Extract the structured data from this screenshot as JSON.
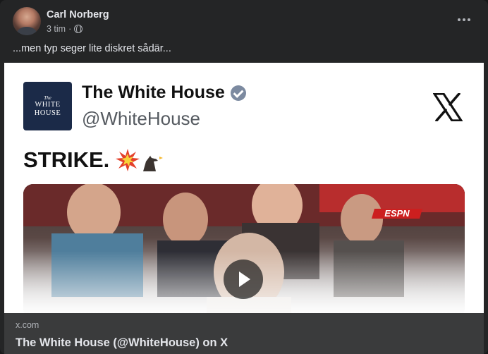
{
  "post": {
    "author": "Carl Norberg",
    "time": "3 tim",
    "separator": "·",
    "privacy_icon": "globe-icon",
    "more_icon": "more-options-icon",
    "text": "...men typ seger lite diskret sådär..."
  },
  "embed": {
    "logo_small": "The",
    "logo_line1": "WHITE",
    "logo_line2": "HOUSE",
    "account_name": "The White House",
    "handle": "@WhiteHouse",
    "platform_icon": "x-logo-icon",
    "tweet_text": "STRIKE.",
    "video_overlay": "ESPN",
    "play_icon": "play-icon"
  },
  "link": {
    "domain": "x.com",
    "title": "The White House (@WhiteHouse) on X"
  },
  "colors": {
    "card_bg": "#242526",
    "footer_bg": "#3a3b3c",
    "text_primary": "#e4e6eb",
    "text_secondary": "#b0b3b8",
    "wh_navy": "#1b2a48"
  }
}
